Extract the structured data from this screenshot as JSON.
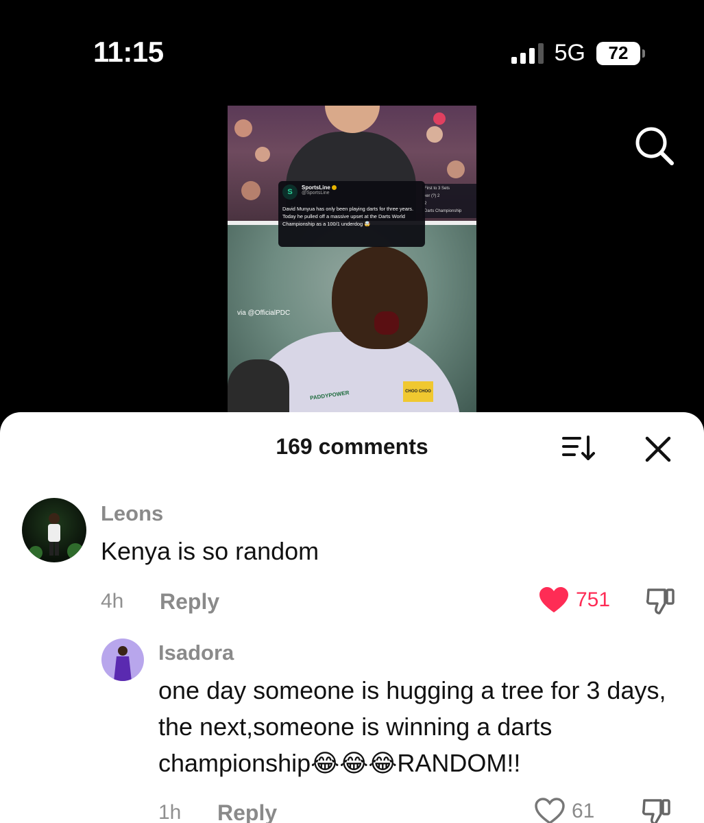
{
  "status_bar": {
    "time": "11:15",
    "network": "5G",
    "battery": "72"
  },
  "video": {
    "tweet": {
      "name": "SportsLine",
      "handle": "@SportsLine",
      "text": "David Munyua has only been playing darts for three years. Today he pulled off a massive upset at the Darts World Championship as a 100/1 underdog 🤯"
    },
    "scoreboard": {
      "header": "First to 3          Sets",
      "row1": "ker (?)          2",
      "row2": "                    2",
      "footer": "Darts Championship"
    },
    "via": "via @OfficialPDC",
    "shirt_logo": "PADDYPOWER",
    "shirt_badge": "CHOO CHOO"
  },
  "comments_sheet": {
    "title": "169 comments",
    "comments": [
      {
        "user": "Leons",
        "text": "Kenya is so random",
        "time": "4h",
        "reply_label": "Reply",
        "likes": "751",
        "liked": true
      },
      {
        "user": "Isadora",
        "text": "one day someone is hugging a tree for 3 days, the next,someone is winning a darts championship😂😂😂RANDOM!!",
        "time": "1h",
        "reply_label": "Reply",
        "likes": "61",
        "liked": false
      }
    ]
  },
  "colors": {
    "like_active": "#fe2c55",
    "muted_text": "#8a8a8a"
  },
  "icons": [
    "signal-icon",
    "battery-icon",
    "search-icon",
    "sort-icon",
    "close-icon",
    "heart-icon",
    "dislike-icon"
  ]
}
